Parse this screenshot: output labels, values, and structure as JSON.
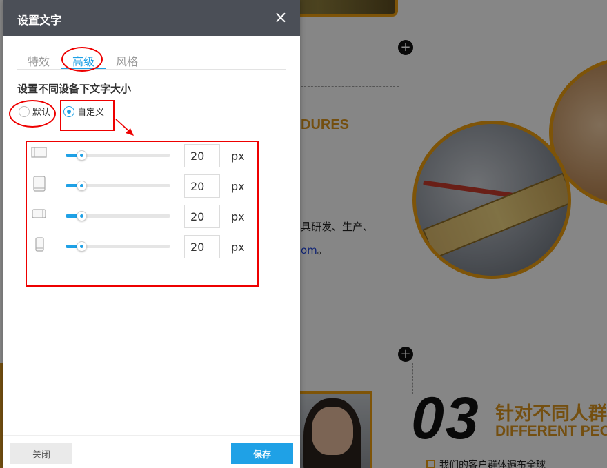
{
  "background": {
    "heading_en_fragment": "DURES",
    "text_fragment": "具研发、生产、",
    "link_fragment": "om",
    "link_tail": "。",
    "number": "03",
    "heading_cn": "针对不同人群订",
    "heading_en": "DIFFERENT PEO",
    "check_item": "我们的客户群体遍布全球",
    "plus_symbol": "+"
  },
  "dialog": {
    "title": "设置文字",
    "close_symbol": "×",
    "tabs": [
      {
        "label": "特效",
        "active": false
      },
      {
        "label": "高级",
        "active": true
      },
      {
        "label": "风格",
        "active": false
      }
    ],
    "section_title": "设置不同设备下文字大小",
    "radio_options": [
      {
        "label": "默认",
        "checked": false
      },
      {
        "label": "自定义",
        "checked": true
      }
    ],
    "device_sizes": [
      {
        "device": "desktop-icon",
        "value": "20",
        "unit": "px",
        "slider_fraction": 0.15
      },
      {
        "device": "tablet-icon",
        "value": "20",
        "unit": "px",
        "slider_fraction": 0.15
      },
      {
        "device": "tablet-landscape-icon",
        "value": "20",
        "unit": "px",
        "slider_fraction": 0.15
      },
      {
        "device": "mobile-icon",
        "value": "20",
        "unit": "px",
        "slider_fraction": 0.15
      }
    ],
    "footer": {
      "close_label": "关闭",
      "save_label": "保存"
    }
  },
  "colors": {
    "accent": "#1fa1e6",
    "header_bg": "#4b4f57",
    "annotation": "#e00000",
    "brand_orange": "#d4901e"
  }
}
